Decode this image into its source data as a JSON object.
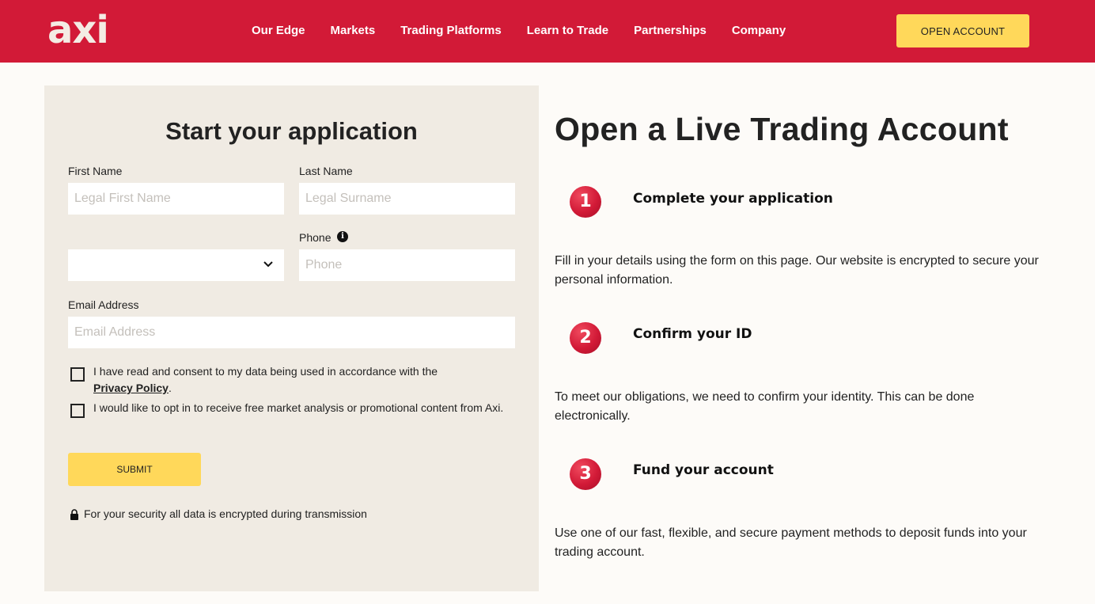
{
  "header": {
    "logo": "axi",
    "nav": [
      "Our Edge",
      "Markets",
      "Trading Platforms",
      "Learn to Trade",
      "Partnerships",
      "Company"
    ],
    "open_account_label": "OPEN ACCOUNT",
    "background_color": "#d21a37",
    "accent_color": "#ffd85a"
  },
  "form": {
    "title": "Start your application",
    "first_name": {
      "label": "First Name",
      "placeholder": "Legal First Name",
      "value": ""
    },
    "last_name": {
      "label": "Last Name",
      "placeholder": "Legal Surname",
      "value": ""
    },
    "country_code": {
      "value": "",
      "icon": "chevron-down-icon"
    },
    "phone": {
      "label": "Phone",
      "placeholder": "Phone",
      "value": "",
      "icon": "info-icon"
    },
    "email": {
      "label": "Email Address",
      "placeholder": "Email Address",
      "value": ""
    },
    "consent_privacy": {
      "text": "I have read and consent to my data being used in accordance with the",
      "link": "Privacy Policy",
      "suffix": ".",
      "checked": false
    },
    "consent_marketing": {
      "text": "I would like to opt in to receive free market analysis or promotional content from Axi.",
      "checked": false
    },
    "submit_label": "SUBMIT",
    "security_note": "For your security all data is encrypted during transmission",
    "security_icon": "lock-icon"
  },
  "main": {
    "title": "Open a Live Trading Account",
    "steps": [
      {
        "number": "1",
        "title": "Complete your application",
        "description": "Fill in your details using the form on this page. Our website is encrypted to secure your personal information."
      },
      {
        "number": "2",
        "title": "Confirm your ID",
        "description": "To meet our obligations, we need to confirm your identity. This can be done electronically."
      },
      {
        "number": "3",
        "title": "Fund your account",
        "description": "Use one of our fast, flexible, and secure payment methods to deposit funds into your trading account."
      }
    ]
  }
}
